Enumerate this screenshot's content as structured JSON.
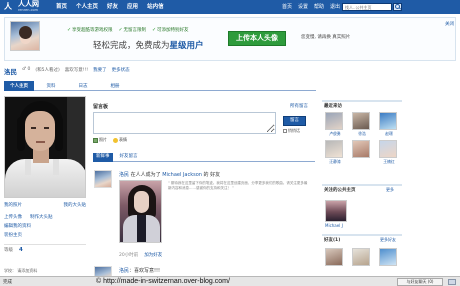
{
  "nav": {
    "logo_mark": "人",
    "logo_text": "人人网",
    "logo_sub": "renren.com",
    "links": [
      "首页",
      "个人主页",
      "好友",
      "应用",
      "站内信"
    ],
    "top_links": [
      "首页",
      "设置",
      "帮助",
      "退出"
    ],
    "search_placeholder": "找人..公共主页"
  },
  "promo": {
    "avatar_name": "洛民",
    "checks": [
      "享受超酷等游戏权限",
      "无留言限制",
      "可添加特别好友"
    ],
    "headline_prefix": "轻松完成，免费成为",
    "headline_highlight": "星级用户",
    "button": "上传本人头像",
    "side_text": "您变慢, 请再换 真实照片",
    "close": "关闭"
  },
  "profile": {
    "name": "洛民",
    "meta": [
      "♂ 0",
      "(和5人看过)",
      "喜欢写意!!!",
      "我要了",
      "更多状态"
    ]
  },
  "tabs": [
    "个人主页",
    "资料",
    "日志",
    "相册"
  ],
  "left": {
    "links_row1": [
      "我的照片",
      "我的大头贴"
    ],
    "links": [
      "上传头像",
      "制作大头贴"
    ],
    "lines": [
      "编辑我的资料",
      "装扮主页"
    ],
    "stat_label": "人气",
    "stat_value": "4",
    "stat_prefix": "等级",
    "school": "学校：   请添加资料"
  },
  "board": {
    "title": "留言板",
    "all_link": "所有留言",
    "submit": "留言",
    "private": "悄悄话",
    "tools": [
      "照片",
      "表情"
    ]
  },
  "feed_tabs": [
    "新鲜事",
    "好友留言"
  ],
  "feed": [
    {
      "user": "洛民",
      "action": " 在人人成为了 ",
      "target": "Michael Jackson",
      "tail": " 的 好友",
      "quote": "“ 期待我在这里留下你的笔迹。我将在这里创建页面，分享更多我们的歌曲。请关注更多最新内容和消息……感谢你的支持和关注！ ”",
      "time": "20小时前",
      "link": "加为好友"
    },
    {
      "user": "洛民",
      "action": "：喜欢写意!!!",
      "target": "",
      "tail": ""
    }
  ],
  "right": {
    "visitors_title": "最近来访",
    "visitors_more": "",
    "visitors": [
      "卢俊勇",
      "徐浩",
      "赵璟",
      "汪静涛",
      "",
      "王楠红"
    ],
    "pages_title": "关注的公共主页",
    "pages_more": "更多",
    "page_name": "Michael J",
    "friends_title": "好友",
    "friends_count": "(1)",
    "friends_more": "更多好友"
  },
  "status_bar": {
    "done": "完成",
    "copyright": "© http://made-in-switzernan.over-blog.com/",
    "tab": "与好友聊天 (0)"
  },
  "colors": {
    "brand_blue": "#1f5ba6",
    "promo_green": "#2e9b3c"
  }
}
